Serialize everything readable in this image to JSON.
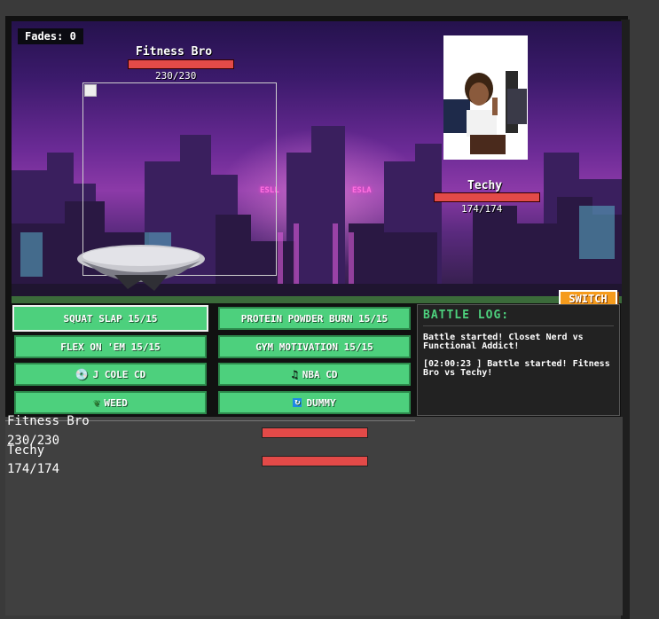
{
  "hud": {
    "fades_label": "Fades: 0"
  },
  "player": {
    "name": "Fitness Bro",
    "hp_text": "230/230",
    "hp_fraction": 1.0
  },
  "enemy": {
    "name": "Techy",
    "hp_text": "174/174",
    "hp_fraction": 1.0
  },
  "scene": {
    "neon_left": "ESLL",
    "neon_right": "ESLA"
  },
  "switch_label": "SWITCH",
  "moves": [
    {
      "label": "SQUAT SLAP 15/15",
      "icon": ""
    },
    {
      "label": "PROTEIN POWDER BURN 15/15",
      "icon": ""
    },
    {
      "label": "FLEX ON 'EM 15/15",
      "icon": ""
    },
    {
      "label": "GYM MOTIVATION 15/15",
      "icon": ""
    },
    {
      "label": "J COLE CD",
      "icon": "cd-icon"
    },
    {
      "label": "NBA CD",
      "icon": "music-note-icon"
    },
    {
      "label": "WEED",
      "icon": "leaf-icon"
    },
    {
      "label": "DUMMY",
      "icon": "refresh-icon"
    }
  ],
  "battle_log": {
    "title": "BATTLE LOG:",
    "entries": [
      "Battle started! Closet Nerd vs Functional Addict!",
      "[02:00:23 ] Battle started! Fitness Bro vs Techy!"
    ]
  },
  "lower_panel": {
    "player_name": "Fitness Bro",
    "player_hp": "230/230",
    "enemy_name": "Techy",
    "enemy_hp": "174/174"
  },
  "colors": {
    "move_button": "#4dd07d",
    "hp_bar": "#e34a48",
    "switch_button": "#f59b1c",
    "log_title": "#4dd07d"
  }
}
